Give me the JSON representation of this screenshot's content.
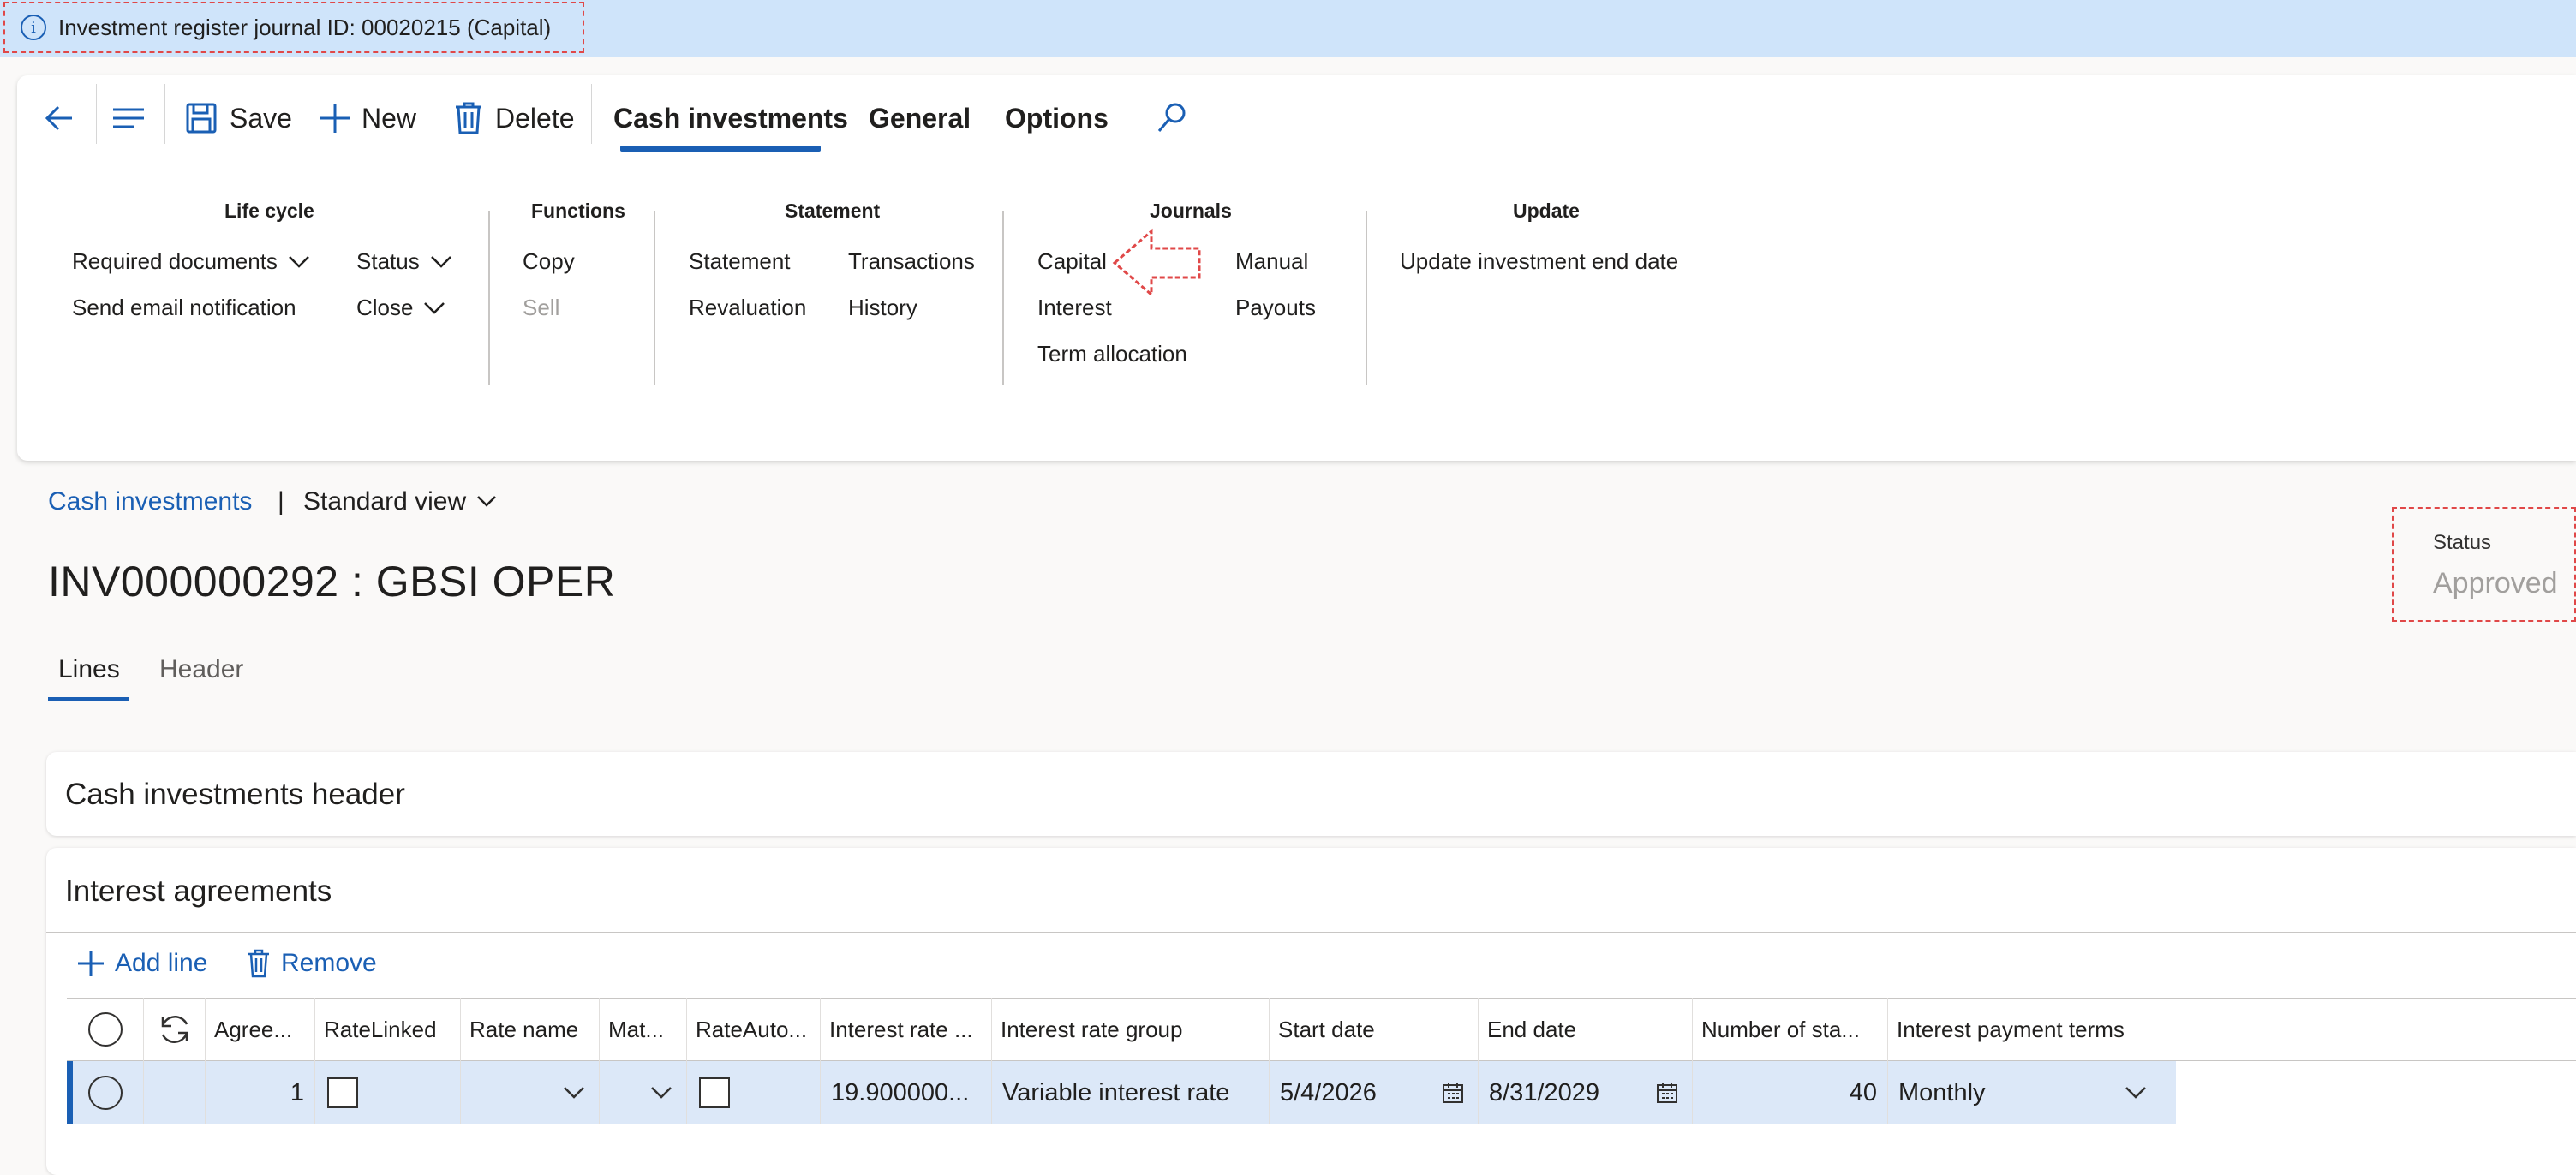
{
  "infobar": {
    "message": "Investment register journal ID: 00020215 (Capital)",
    "info_icon": "info-icon"
  },
  "toolbar": {
    "back_icon": "back-arrow-icon",
    "menu_icon": "hamburger-menu-icon",
    "save_label": "Save",
    "new_label": "New",
    "delete_label": "Delete",
    "tabs": [
      {
        "label": "Cash investments",
        "active": true
      },
      {
        "label": "General",
        "active": false
      },
      {
        "label": "Options",
        "active": false
      }
    ],
    "search_icon": "search-icon"
  },
  "ribbon": {
    "lifecycle": {
      "title": "Life cycle",
      "required_documents": "Required documents",
      "status": "Status",
      "send_email": "Send email notification",
      "close": "Close"
    },
    "functions": {
      "title": "Functions",
      "copy": "Copy",
      "sell": "Sell"
    },
    "statement": {
      "title": "Statement",
      "statement": "Statement",
      "transactions": "Transactions",
      "revaluation": "Revaluation",
      "history": "History"
    },
    "journals": {
      "title": "Journals",
      "capital": "Capital",
      "manual": "Manual",
      "interest": "Interest",
      "payouts": "Payouts",
      "term_allocation": "Term allocation"
    },
    "update": {
      "title": "Update",
      "update_end_date": "Update investment end date"
    }
  },
  "breadcrumb": {
    "link": "Cash investments",
    "separator": "|",
    "view": "Standard view"
  },
  "page": {
    "title": "INV000000292 : GBSI OPER",
    "tabs": [
      {
        "label": "Lines",
        "active": true
      },
      {
        "label": "Header",
        "active": false
      }
    ]
  },
  "status": {
    "label": "Status",
    "value": "Approved"
  },
  "sections": {
    "header_title": "Cash investments header",
    "interest_title": "Interest agreements"
  },
  "grid_actions": {
    "add_line": "Add line",
    "remove": "Remove"
  },
  "grid": {
    "columns": [
      "Agree...",
      "RateLinked",
      "Rate name",
      "Mat...",
      "RateAuto...",
      "Interest rate ...",
      "Interest rate group",
      "Start date",
      "End date",
      "Number of sta...",
      "Interest payment terms"
    ],
    "rows": [
      {
        "agreement": "1",
        "rate_linked": false,
        "rate_name": "",
        "mat": "",
        "rate_auto": false,
        "interest_rate": "19.900000...",
        "interest_rate_group": "Variable interest rate",
        "start_date": "5/4/2026",
        "end_date": "8/31/2029",
        "number_of_statements": "40",
        "interest_payment_terms": "Monthly"
      }
    ]
  },
  "colors": {
    "accent": "#1a5fb4",
    "selected_row": "#dce8f8",
    "annotation": "#e04848"
  }
}
